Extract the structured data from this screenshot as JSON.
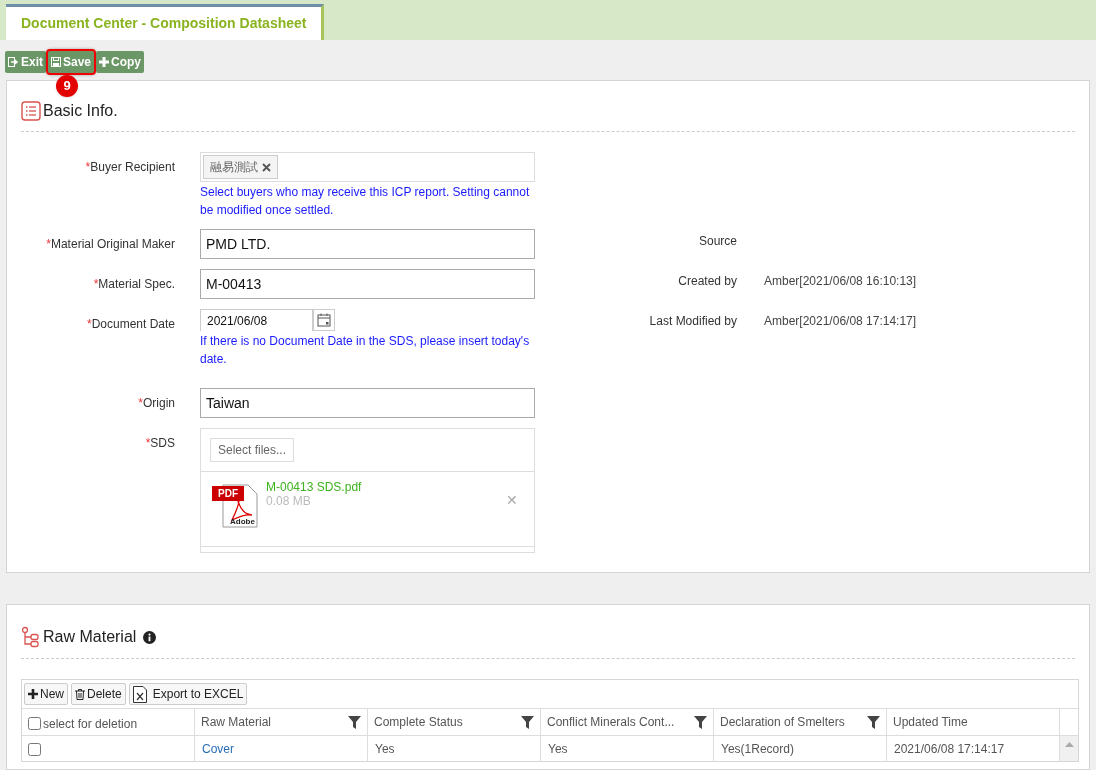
{
  "tab": {
    "label": "Document Center - Composition Datasheet",
    "selected": true
  },
  "toolbar": [
    {
      "kind": "exit",
      "label": "Exit",
      "highlighted": false
    },
    {
      "kind": "save",
      "label": "Save",
      "highlighted": true
    },
    {
      "kind": "copy",
      "label": "Copy",
      "highlighted": false
    }
  ],
  "step_badge": "9",
  "basic_info": {
    "title": "Basic Info.",
    "fields": [
      {
        "kind": "tags",
        "required_mark": "*",
        "label": "Buyer Recipient",
        "tags": [
          "融易測試"
        ],
        "hint": "Select buyers who may receive this ICP report. Setting cannot be modified once settled."
      },
      {
        "kind": "text",
        "required_mark": "*",
        "label": "Material Original Maker",
        "value": "PMD LTD."
      },
      {
        "kind": "text",
        "required_mark": "*",
        "label": "Material Spec.",
        "value": "M-00413"
      },
      {
        "kind": "date",
        "required_mark": "*",
        "label": "Document Date",
        "value": "2021/06/08",
        "hint": "If there is no Document Date in the SDS, please insert today's date."
      },
      {
        "kind": "text",
        "required_mark": "*",
        "label": "Origin",
        "value": "Taiwan"
      },
      {
        "kind": "file",
        "required_mark": "*",
        "label": "SDS",
        "button": "Select files...",
        "files": [
          {
            "name": "M-00413 SDS.pdf",
            "size": "0.08 MB",
            "badge": "PDF",
            "brand": "Adobe",
            "remove": "✕"
          }
        ]
      }
    ],
    "info": [
      {
        "label": "Source"
      },
      {
        "label": "Created by",
        "value": "Amber[2021/06/08 16:10:13]"
      },
      {
        "label": "Last Modified by",
        "value": "Amber[2021/06/08 17:14:17]"
      }
    ]
  },
  "raw_material": {
    "title": "Raw Material",
    "actions": [
      {
        "kind": "new",
        "label": "New"
      },
      {
        "kind": "delete",
        "label": "Delete"
      },
      {
        "kind": "excel",
        "label": "Export to EXCEL"
      }
    ],
    "columns": [
      {
        "label": "select for deletion",
        "kind": "check",
        "filter": false,
        "checked": false
      },
      {
        "label": "Raw Material",
        "kind": "text",
        "filter": true
      },
      {
        "label": "Complete Status",
        "kind": "text",
        "filter": true
      },
      {
        "label": "Conflict Minerals Cont...",
        "kind": "text",
        "filter": true
      },
      {
        "label": "Declaration of Smelters",
        "kind": "text",
        "filter": true
      },
      {
        "label": "Updated Time",
        "kind": "text",
        "filter": false
      }
    ],
    "rows": [
      {
        "checked": false,
        "cells": [
          "",
          "Cover",
          "Yes",
          "Yes",
          "Yes(1Record)",
          "2021/06/08 17:14:17"
        ]
      }
    ]
  }
}
